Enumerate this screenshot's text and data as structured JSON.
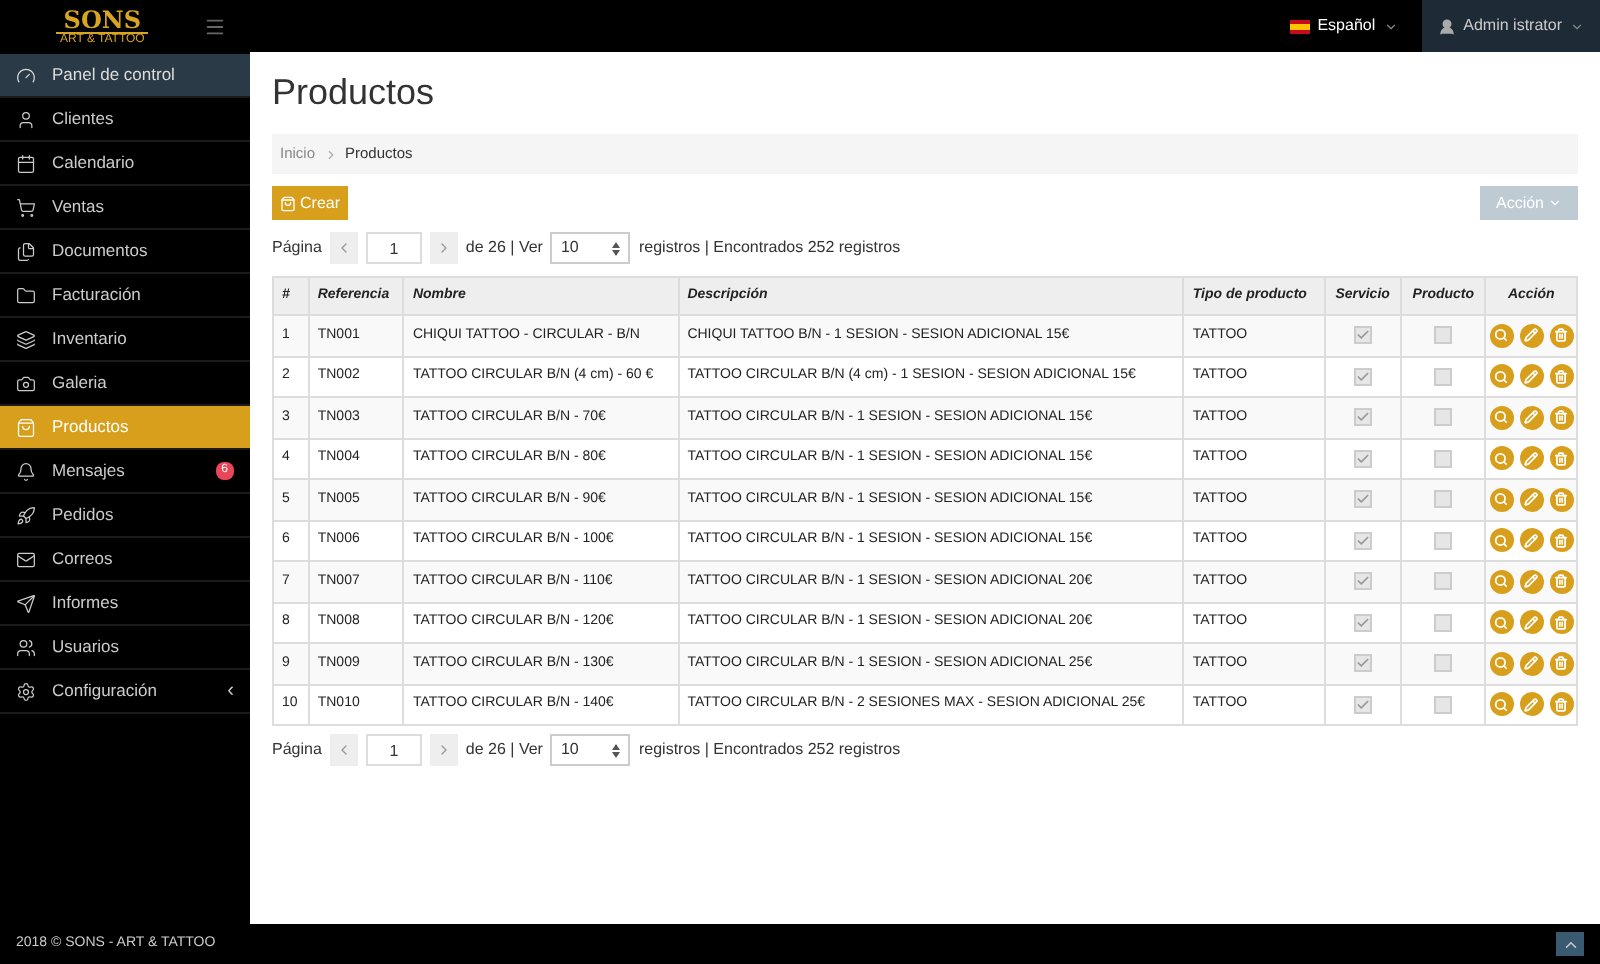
{
  "brand": {
    "name": "SONS",
    "tagline": "ART & TATTOO"
  },
  "topbar": {
    "language": "Español",
    "user": "Admin istrator"
  },
  "sidebar": {
    "items": [
      {
        "label": "Panel de control",
        "selected": false,
        "kind": "header"
      },
      {
        "label": "Clientes",
        "selected": false
      },
      {
        "label": "Calendario",
        "selected": false
      },
      {
        "label": "Ventas",
        "selected": false
      },
      {
        "label": "Documentos",
        "selected": false
      },
      {
        "label": "Facturación",
        "selected": false
      },
      {
        "label": "Inventario",
        "selected": false
      },
      {
        "label": "Galeria",
        "selected": false
      },
      {
        "label": "Productos",
        "selected": true
      },
      {
        "label": "Mensajes",
        "selected": false,
        "badge": "6"
      },
      {
        "label": "Pedidos",
        "selected": false
      },
      {
        "label": "Correos",
        "selected": false
      },
      {
        "label": "Informes",
        "selected": false
      },
      {
        "label": "Usuarios",
        "selected": false
      },
      {
        "label": "Configuración",
        "selected": false,
        "caret": "‹"
      }
    ]
  },
  "page": {
    "title": "Productos",
    "breadcrumb": [
      "Inicio",
      "Productos"
    ],
    "create_button": "Crear",
    "action_button": "Acción"
  },
  "pager_top": {
    "label": "Página",
    "page": "1",
    "of": "de 26 | Ver",
    "per_page": "10",
    "summary": "registros | Encontrados 252 registros"
  },
  "table": {
    "columns": [
      "#",
      "Referencia",
      "Nombre",
      "Descripción",
      "Tipo de producto",
      "Servicio",
      "Producto",
      "Acción"
    ],
    "rows": [
      {
        "n": "1",
        "ref": "TN001",
        "name": "CHIQUI TATTOO - CIRCULAR - B/N",
        "desc": "CHIQUI TATTOO B/N - 1 SESION - SESION ADICIONAL 15€",
        "type": "TATTOO",
        "servicio": true,
        "producto": false
      },
      {
        "n": "2",
        "ref": "TN002",
        "name": "TATTOO CIRCULAR B/N (4 cm) - 60 €",
        "desc": "TATTOO CIRCULAR B/N (4 cm) - 1 SESION - SESION ADICIONAL 15€",
        "type": "TATTOO",
        "servicio": true,
        "producto": false
      },
      {
        "n": "3",
        "ref": "TN003",
        "name": "TATTOO CIRCULAR B/N - 70€",
        "desc": "TATTOO CIRCULAR B/N - 1 SESION - SESION ADICIONAL 15€",
        "type": "TATTOO",
        "servicio": true,
        "producto": false
      },
      {
        "n": "4",
        "ref": "TN004",
        "name": "TATTOO CIRCULAR B/N - 80€",
        "desc": "TATTOO CIRCULAR B/N - 1 SESION - SESION ADICIONAL 15€",
        "type": "TATTOO",
        "servicio": true,
        "producto": false
      },
      {
        "n": "5",
        "ref": "TN005",
        "name": "TATTOO CIRCULAR B/N - 90€",
        "desc": "TATTOO CIRCULAR B/N - 1 SESION - SESION ADICIONAL 15€",
        "type": "TATTOO",
        "servicio": true,
        "producto": false
      },
      {
        "n": "6",
        "ref": "TN006",
        "name": "TATTOO CIRCULAR B/N - 100€",
        "desc": "TATTOO CIRCULAR B/N - 1 SESION - SESION ADICIONAL 15€",
        "type": "TATTOO",
        "servicio": true,
        "producto": false
      },
      {
        "n": "7",
        "ref": "TN007",
        "name": "TATTOO CIRCULAR B/N - 110€",
        "desc": "TATTOO CIRCULAR B/N - 1 SESION - SESION ADICIONAL 20€",
        "type": "TATTOO",
        "servicio": true,
        "producto": false
      },
      {
        "n": "8",
        "ref": "TN008",
        "name": "TATTOO CIRCULAR B/N - 120€",
        "desc": "TATTOO CIRCULAR B/N - 1 SESION - SESION ADICIONAL 20€",
        "type": "TATTOO",
        "servicio": true,
        "producto": false
      },
      {
        "n": "9",
        "ref": "TN009",
        "name": "TATTOO CIRCULAR B/N - 130€",
        "desc": "TATTOO CIRCULAR B/N - 1 SESION - SESION ADICIONAL 25€",
        "type": "TATTOO",
        "servicio": true,
        "producto": false
      },
      {
        "n": "10",
        "ref": "TN010",
        "name": "TATTOO CIRCULAR B/N - 140€",
        "desc": "TATTOO CIRCULAR B/N - 2 SESIONES MAX - SESION ADICIONAL 25€",
        "type": "TATTOO",
        "servicio": true,
        "producto": false
      }
    ]
  },
  "pager_bottom": {
    "label": "Página",
    "page": "1",
    "of": "de 26 | Ver",
    "per_page": "10",
    "summary": "registros | Encontrados 252 registros"
  },
  "footer": {
    "text": "2018 © SONS - ART & TATTOO"
  }
}
